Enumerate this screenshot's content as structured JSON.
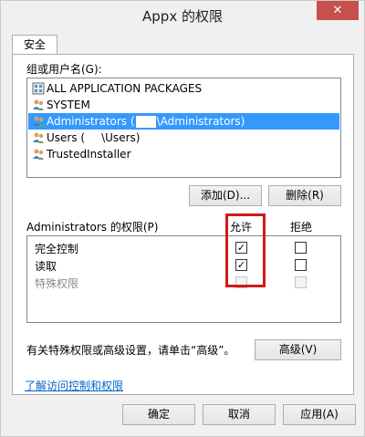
{
  "window": {
    "title": "Appx 的权限",
    "close_glyph": "✕"
  },
  "tabs": [
    {
      "label": "安全"
    }
  ],
  "group_section": {
    "label": "组或用户名(G):",
    "items": [
      {
        "label_start": "ALL APPLICATION PACKAGES",
        "label_end": "",
        "icon": "packages-icon",
        "selected": false
      },
      {
        "label_start": "SYSTEM",
        "label_end": "",
        "icon": "user-group-icon",
        "selected": false
      },
      {
        "label_start": "Administrators (",
        "label_end": "\\Administrators)",
        "icon": "user-group-icon",
        "selected": true
      },
      {
        "label_start": "Users (",
        "label_end": "\\Users)",
        "icon": "user-group-icon",
        "selected": false
      },
      {
        "label_start": "TrustedInstaller",
        "label_end": "",
        "icon": "user-group-icon",
        "selected": false
      }
    ],
    "add_button": "添加(D)...",
    "remove_button": "删除(R)"
  },
  "permissions": {
    "header": "Administrators 的权限(P)",
    "allow_header": "允许",
    "deny_header": "拒绝",
    "rows": [
      {
        "label": "完全控制",
        "allow": true,
        "deny": false,
        "disabled": false
      },
      {
        "label": "读取",
        "allow": true,
        "deny": false,
        "disabled": false
      },
      {
        "label": "特殊权限",
        "allow": false,
        "deny": false,
        "disabled": true
      }
    ],
    "highlight_color": "#d11a1a"
  },
  "advanced": {
    "note": "有关特殊权限或高级设置，请单击“高级”。",
    "button": "高级(V)"
  },
  "help_link": "了解访问控制和权限",
  "footer": {
    "ok": "确定",
    "cancel": "取消",
    "apply": "应用(A)"
  },
  "colors": {
    "selection": "#3399ff",
    "link": "#0066cc",
    "close": "#c7504c"
  }
}
